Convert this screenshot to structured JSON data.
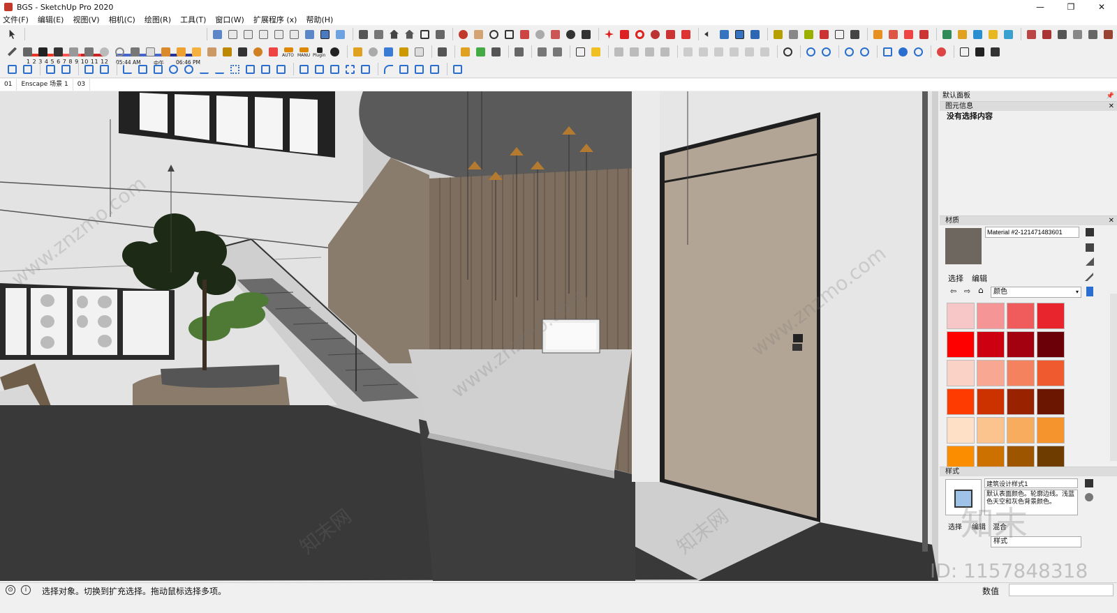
{
  "window": {
    "title": "BGS - SketchUp Pro 2020",
    "minimize": "—",
    "maximize": "❐",
    "close": "✕"
  },
  "menu": [
    "文件(F)",
    "编辑(E)",
    "视图(V)",
    "相机(C)",
    "绘图(R)",
    "工具(T)",
    "窗口(W)",
    "扩展程序 (x)",
    "帮助(H)"
  ],
  "shadow": {
    "months": "1 2 3 4 5 6 7 8 9 10 11 12",
    "time_start": "05:44 AM",
    "time_mid": "中午",
    "time_end": "06:46 PM"
  },
  "toolbar_labels": {
    "auto": "AUTO",
    "manu": "MANU",
    "plugin": "Plugin"
  },
  "scenes": [
    "01",
    "Enscape 场景 1",
    "03"
  ],
  "panel": {
    "title": "默认面板",
    "entity_info": {
      "header": "图元信息",
      "text": "没有选择内容"
    },
    "materials": {
      "header": "材质",
      "name": "Material #2-121471483601",
      "tab_select": "选择",
      "tab_edit": "编辑",
      "library": "颜色",
      "preview_color": "#6e6760",
      "swatches": [
        "#f7c6c6",
        "#f59595",
        "#f05c5c",
        "#e8242c",
        "#fe0000",
        "#cc0010",
        "#a30010",
        "#6c0009",
        "#fbd2c6",
        "#f8a793",
        "#f4825f",
        "#f05a2f",
        "#fe3b00",
        "#cc3100",
        "#992200",
        "#6a1600",
        "#fde0c6",
        "#fbc48f",
        "#f8ad5e",
        "#f5932c",
        "#fa8d00",
        "#cc7000",
        "#9e5500",
        "#6f3c00"
      ]
    },
    "styles": {
      "header": "样式",
      "name": "建筑设计样式1",
      "description": "默认表面颜色。轮廓边线。浅蓝色天空和灰色背景颜色。",
      "tab_select": "选择",
      "tab_edit": "编辑",
      "tab_mix": "混合",
      "library": "样式"
    }
  },
  "status": {
    "message": "选择对象。切换到扩充选择。拖动鼠标选择多项。",
    "measure_label": "数值"
  },
  "watermarks": {
    "site": "www.znzmo.com",
    "brand": "知末网",
    "big_brand": "知末",
    "id": "ID: 1157848318"
  }
}
